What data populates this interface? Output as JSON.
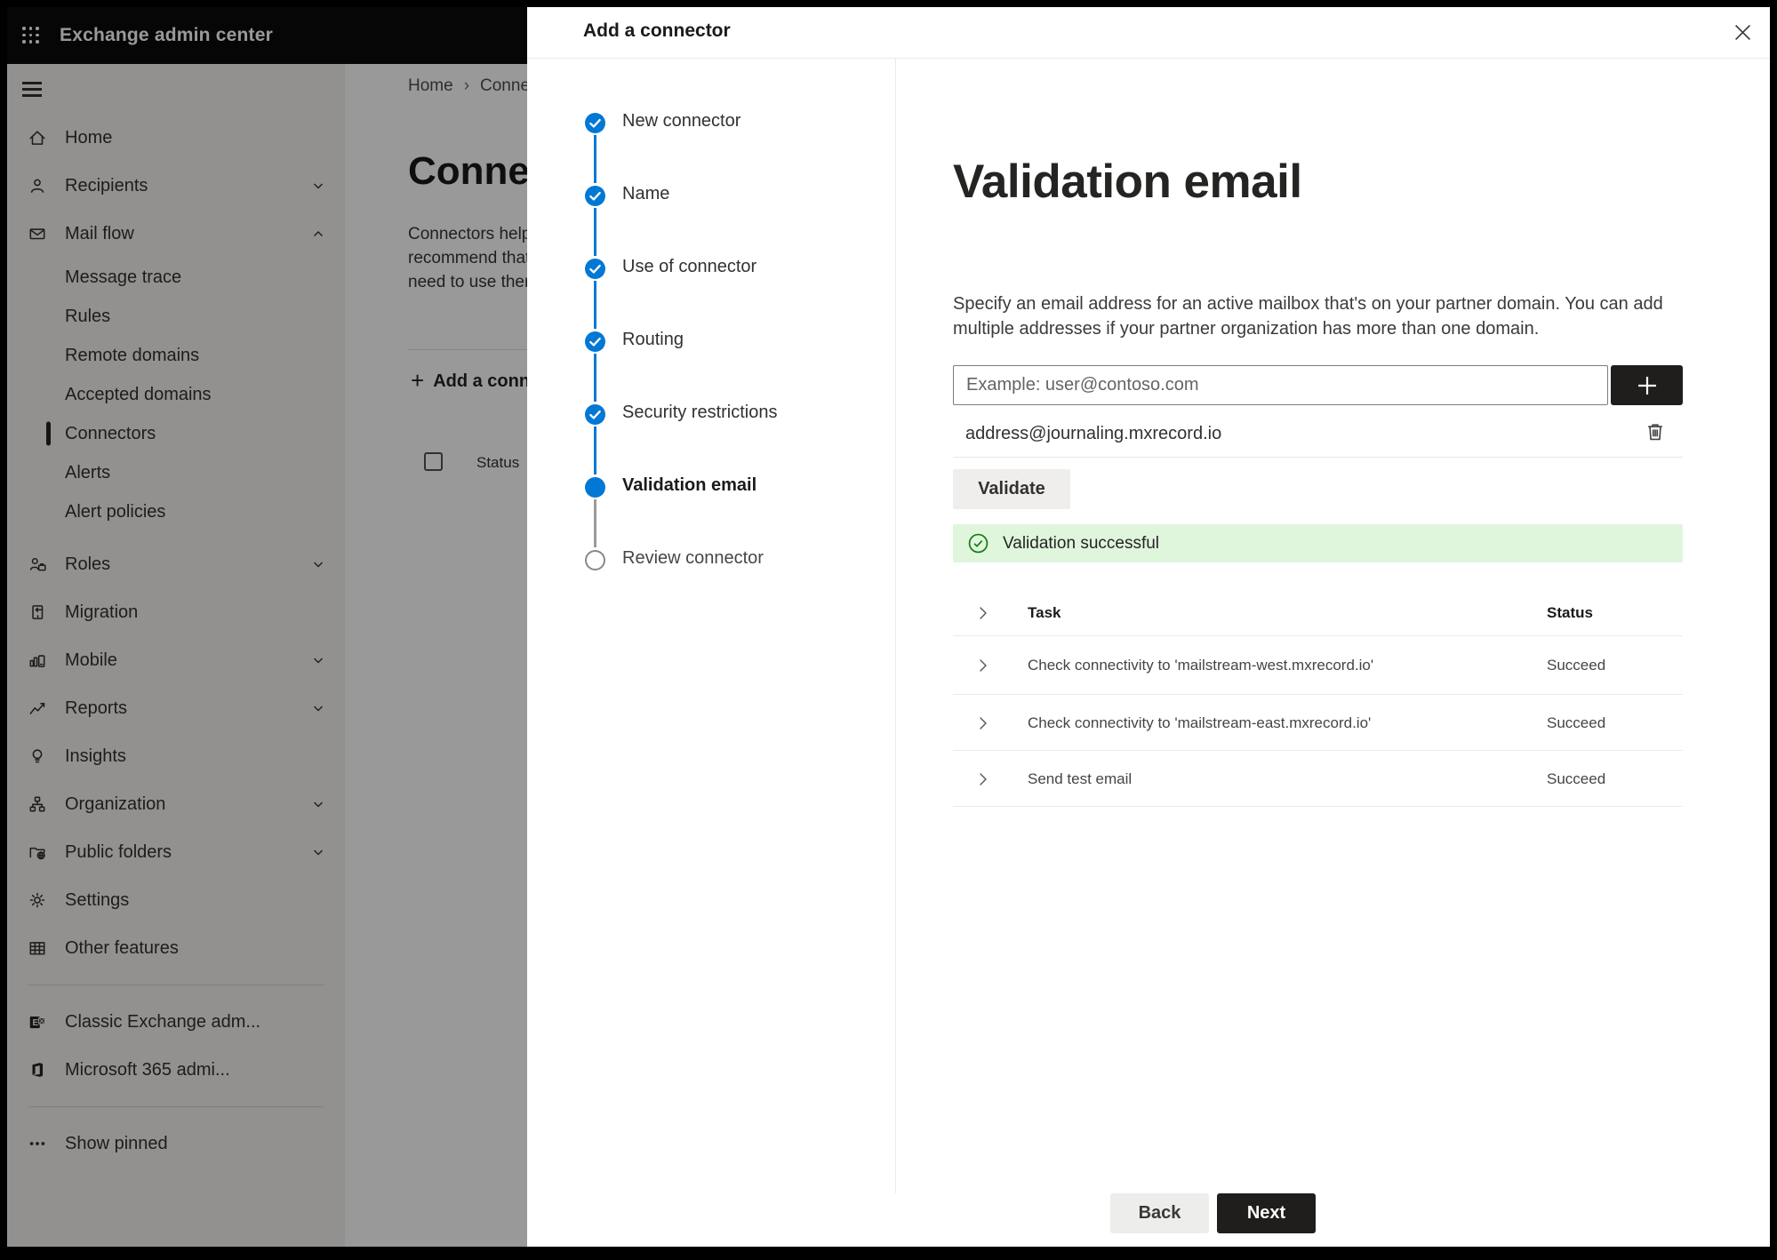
{
  "topbar": {
    "app_title": "Exchange admin center",
    "waffle_icon": "app-launcher-icon"
  },
  "sidebar": {
    "hamburger_icon": "hamburger-menu-icon",
    "items": [
      {
        "id": "home",
        "label": "Home",
        "icon": "home-icon"
      },
      {
        "id": "recipients",
        "label": "Recipients",
        "icon": "person-icon",
        "chevron": "down"
      },
      {
        "id": "mail-flow",
        "label": "Mail flow",
        "icon": "mail-icon",
        "chevron": "up",
        "expanded": true
      },
      {
        "id": "message-trace",
        "label": "Message trace",
        "sub": true
      },
      {
        "id": "rules",
        "label": "Rules",
        "sub": true
      },
      {
        "id": "remote-domains",
        "label": "Remote domains",
        "sub": true
      },
      {
        "id": "accepted-domains",
        "label": "Accepted domains",
        "sub": true
      },
      {
        "id": "connectors",
        "label": "Connectors",
        "sub": true,
        "selected": true
      },
      {
        "id": "alerts",
        "label": "Alerts",
        "sub": true
      },
      {
        "id": "alert-policies",
        "label": "Alert policies",
        "sub": true
      },
      {
        "id": "roles",
        "label": "Roles",
        "icon": "roles-icon",
        "chevron": "down",
        "gap": true
      },
      {
        "id": "migration",
        "label": "Migration",
        "icon": "migration-icon"
      },
      {
        "id": "mobile",
        "label": "Mobile",
        "icon": "mobile-icon",
        "chevron": "down"
      },
      {
        "id": "reports",
        "label": "Reports",
        "icon": "reports-icon",
        "chevron": "down"
      },
      {
        "id": "insights",
        "label": "Insights",
        "icon": "insights-icon"
      },
      {
        "id": "organization",
        "label": "Organization",
        "icon": "organization-icon",
        "chevron": "down"
      },
      {
        "id": "public-folders",
        "label": "Public folders",
        "icon": "public-folders-icon",
        "chevron": "down"
      },
      {
        "id": "settings",
        "label": "Settings",
        "icon": "settings-icon"
      },
      {
        "id": "other-features",
        "label": "Other features",
        "icon": "other-features-icon"
      },
      {
        "divider": true
      },
      {
        "id": "classic-exchange",
        "label": "Classic Exchange adm...",
        "icon": "exchange-logo-icon"
      },
      {
        "id": "microsoft-365",
        "label": "Microsoft 365 admi...",
        "icon": "microsoft-365-icon"
      },
      {
        "divider": true
      },
      {
        "id": "show-pinned",
        "label": "Show pinned",
        "icon": "ellipsis-icon"
      }
    ]
  },
  "background_page": {
    "breadcrumb": {
      "home": "Home",
      "separator": "›",
      "current": "Connectors"
    },
    "heading": "Connectors",
    "intro_lines": [
      "Connectors help",
      "recommend that",
      "need to use ther"
    ],
    "add_button_label": "Add a connector",
    "table_status_header": "Status"
  },
  "panel": {
    "title": "Add a connector",
    "close_icon": "close-icon",
    "steps": [
      {
        "label": "New connector",
        "state": "complete"
      },
      {
        "label": "Name",
        "state": "complete"
      },
      {
        "label": "Use of connector",
        "state": "complete"
      },
      {
        "label": "Routing",
        "state": "complete"
      },
      {
        "label": "Security restrictions",
        "state": "complete"
      },
      {
        "label": "Validation email",
        "state": "current"
      },
      {
        "label": "Review connector",
        "state": "upcoming"
      }
    ],
    "content": {
      "heading": "Validation email",
      "description_lines": [
        "Specify an email address for an active mailbox that's on your partner domain. You can add",
        "multiple addresses if your partner organization has more than one domain."
      ],
      "email_input": {
        "placeholder": "Example: user@contoso.com",
        "value": ""
      },
      "add_email_icon": "plus-icon",
      "addresses": [
        {
          "email": "address@journaling.mxrecord.io",
          "delete_icon": "trash-icon"
        }
      ],
      "validate_button": "Validate",
      "success_banner": {
        "icon": "check-circle-icon",
        "text": "Validation successful"
      },
      "results_table": {
        "headers": {
          "task": "Task",
          "status": "Status"
        },
        "rows": [
          {
            "task": "Check connectivity to 'mailstream-west.mxrecord.io'",
            "status": "Succeed"
          },
          {
            "task": "Check connectivity to 'mailstream-east.mxrecord.io'",
            "status": "Succeed"
          },
          {
            "task": "Send test email",
            "status": "Succeed"
          }
        ]
      }
    },
    "footer": {
      "back_button": "Back",
      "next_button": "Next"
    }
  },
  "colors": {
    "accent_blue": "#0078d4",
    "success_green": "#107c10",
    "success_bg": "#dff6dd",
    "topbar": "#0b0b0b"
  }
}
